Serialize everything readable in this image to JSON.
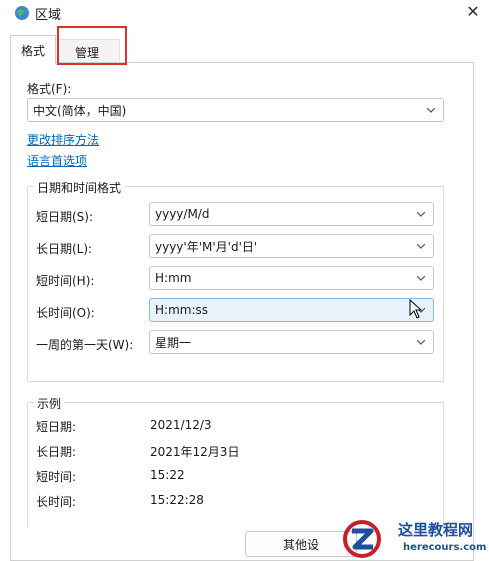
{
  "window": {
    "title": "区域",
    "close_glyph": "✕"
  },
  "tabs": [
    {
      "label": "格式"
    },
    {
      "label": "管理"
    }
  ],
  "format": {
    "label": "格式(F):",
    "value": "中文(简体，中国)"
  },
  "links": {
    "sort": "更改排序方法",
    "language": "语言首选项"
  },
  "datetime": {
    "title": "日期和时间格式",
    "rows": [
      {
        "label": "短日期(S):",
        "value": "yyyy/M/d"
      },
      {
        "label": "长日期(L):",
        "value": "yyyy'年'M'月'd'日'"
      },
      {
        "label": "短时间(H):",
        "value": "H:mm"
      },
      {
        "label": "长时间(O):",
        "value": "H:mm:ss"
      },
      {
        "label": "一周的第一天(W):",
        "value": "星期一"
      }
    ]
  },
  "examples": {
    "title": "示例",
    "rows": [
      {
        "label": "短日期:",
        "value": "2021/12/3"
      },
      {
        "label": "长日期:",
        "value": "2021年12月3日"
      },
      {
        "label": "短时间:",
        "value": "15:22"
      },
      {
        "label": "长时间:",
        "value": "15:22:28"
      }
    ]
  },
  "buttons": {
    "other_settings": "其他设"
  },
  "watermark": {
    "title": "这里教程网",
    "subtitle": "herecours.com"
  },
  "colors": {
    "link": "#0067c0",
    "highlight_box": "#d9342b",
    "focus_bg": "#e8f2fb"
  }
}
